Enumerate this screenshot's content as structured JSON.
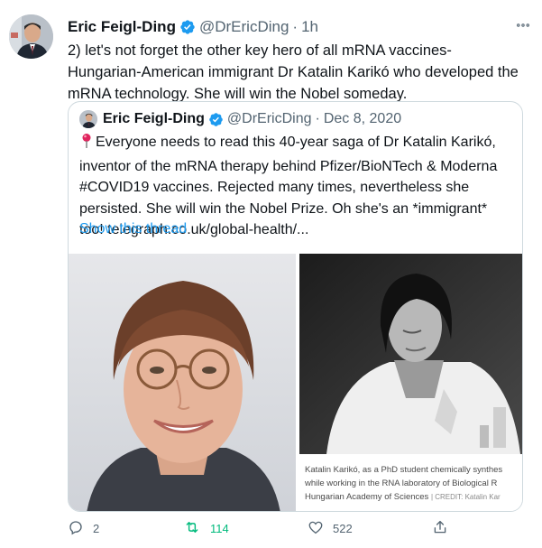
{
  "tweet": {
    "author_name": "Eric Feigl-Ding",
    "handle": "@DrEricDing",
    "separator": "·",
    "time": "1h",
    "text": "2) let's not forget the other key hero of all mRNA vaccines- Hungarian-American immigrant Dr Katalin Karikó who developed the mRNA technology. She will win the Nobel someday."
  },
  "quote": {
    "author_name": "Eric Feigl-Ding",
    "handle": "@DrEricDing",
    "separator": "·",
    "date": "Dec 8, 2020",
    "text": "Everyone needs to read this 40-year saga of Dr Katalin Karikó, inventor of the mRNA therapy behind Pfizer/BioNTech & Moderna #COVID19 vaccines. Rejected many times, nevertheless she persisted. She will win the Nobel Prize. Oh she's an *immigrant* too! telegraph.co.uk/global-health/...",
    "show_thread": "Show this thread",
    "caption_line1": "Katalin Karikó, as a PhD student chemically synthes",
    "caption_line2": "while working in the RNA laboratory of Biological R",
    "caption_line3": "Hungarian Academy of Sciences",
    "caption_credit": "| CREDIT: Katalin Kar"
  },
  "actions": {
    "reply_count": "2",
    "retweet_count": "114",
    "like_count": "522"
  },
  "icons": {
    "verified": "verified-badge-icon",
    "more": "more-options-icon",
    "pin": "round-pushpin-icon",
    "reply": "reply-icon",
    "retweet": "retweet-icon",
    "like": "heart-icon",
    "share": "share-icon"
  },
  "colors": {
    "accent": "#1d9bf0",
    "retweet_green": "#00ba7c",
    "secondary_text": "#536471",
    "border": "#cfd9de"
  }
}
